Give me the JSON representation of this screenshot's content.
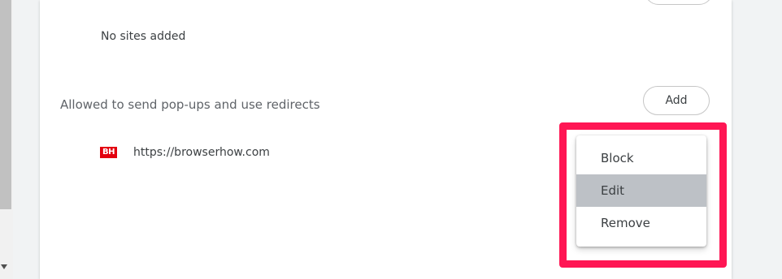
{
  "colors": {
    "highlight": "#ff1654",
    "favicon_bg": "#e3000f",
    "menu_selected": "#bdc1c6"
  },
  "blocked": {
    "empty_text": "No sites added"
  },
  "allowed": {
    "title": "Allowed to send pop-ups and use redirects",
    "add_label": "Add",
    "sites": [
      {
        "favicon_text": "BH",
        "url": "https://browserhow.com"
      }
    ]
  },
  "context_menu": {
    "items": [
      {
        "label": "Block"
      },
      {
        "label": "Edit",
        "selected": true
      },
      {
        "label": "Remove"
      }
    ]
  }
}
